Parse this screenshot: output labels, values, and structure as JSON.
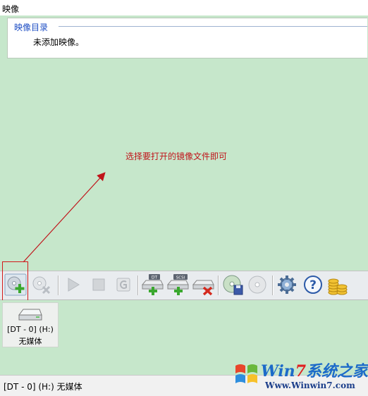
{
  "window": {
    "title": "映像"
  },
  "catalog": {
    "header": "映像目录",
    "empty_text": "未添加映像。"
  },
  "annotation": {
    "text": "选择要打开的镜像文件即可",
    "color": "#c0141a"
  },
  "toolbar": {
    "buttons": [
      {
        "name": "add-image-button",
        "icon": "disc-add-icon",
        "enabled": true
      },
      {
        "name": "remove-image-button",
        "icon": "disc-remove-icon",
        "enabled": false
      },
      {
        "name": "play-button",
        "icon": "play-icon",
        "enabled": false
      },
      {
        "name": "stop-button",
        "icon": "stop-icon",
        "enabled": false
      },
      {
        "name": "refresh-button",
        "icon": "refresh-icon",
        "enabled": false
      },
      {
        "name": "add-dt-drive-button",
        "icon": "dt-drive-add-icon",
        "label": "DT",
        "enabled": true
      },
      {
        "name": "add-scsi-drive-button",
        "icon": "scsi-drive-add-icon",
        "label": "SCSI",
        "enabled": true
      },
      {
        "name": "remove-drive-button",
        "icon": "drive-remove-icon",
        "enabled": true
      },
      {
        "name": "save-image-button",
        "icon": "disc-save-icon",
        "enabled": true
      },
      {
        "name": "burn-disc-button",
        "icon": "disc-icon",
        "enabled": false
      },
      {
        "name": "settings-button",
        "icon": "gear-icon",
        "enabled": true
      },
      {
        "name": "help-button",
        "icon": "help-icon",
        "enabled": true
      },
      {
        "name": "purchase-button",
        "icon": "coins-icon",
        "enabled": true
      }
    ]
  },
  "device": {
    "line1": "[DT - 0] (H:)",
    "line2": "无媒体"
  },
  "status": {
    "text": "[DT - 0] (H:) 无媒体"
  },
  "watermark": {
    "brand_a": "Win",
    "brand_b": "7",
    "brand_c": "系统之家",
    "url": "Www.Winwin7.com"
  },
  "colors": {
    "background": "#c6e7cb",
    "accent": "#1e4ec4",
    "arrow": "#c0141a"
  }
}
